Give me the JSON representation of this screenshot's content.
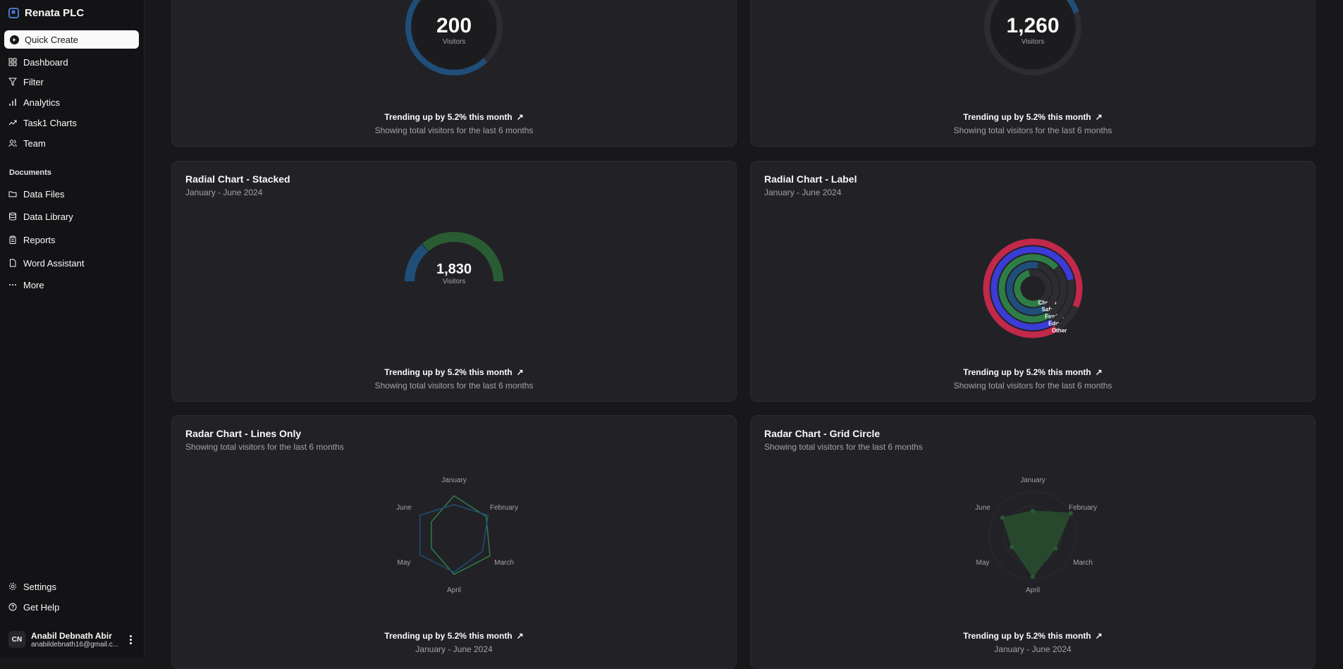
{
  "sidebar": {
    "brand": "Renata PLC",
    "quick_create": "Quick Create",
    "nav": [
      {
        "label": "Dashboard",
        "icon": "dashboard-icon"
      },
      {
        "label": "Filter",
        "icon": "filter-icon"
      },
      {
        "label": "Analytics",
        "icon": "analytics-icon"
      },
      {
        "label": "Task1 Charts",
        "icon": "trend-icon"
      },
      {
        "label": "Team",
        "icon": "team-icon"
      }
    ],
    "documents_label": "Documents",
    "documents": [
      {
        "label": "Data Files",
        "icon": "folder-icon"
      },
      {
        "label": "Data Library",
        "icon": "database-icon"
      },
      {
        "label": "Reports",
        "icon": "clipboard-icon"
      },
      {
        "label": "Word Assistant",
        "icon": "file-icon"
      },
      {
        "label": "More",
        "icon": "ellipsis-icon"
      }
    ],
    "footer": [
      {
        "label": "Settings",
        "icon": "gear-icon"
      },
      {
        "label": "Get Help",
        "icon": "help-icon"
      }
    ],
    "user": {
      "initials": "CN",
      "name": "Anabil Debnath Abir",
      "email": "anabildebnath16@gmail.c..."
    }
  },
  "common": {
    "trend": "Trending up by 5.2% this month",
    "footer_visitors": "Showing total visitors for the last 6 months",
    "date_range": "January - June 2024",
    "visitors_label": "Visitors"
  },
  "cards": {
    "top_left": {
      "value": "200"
    },
    "top_right": {
      "value": "1,260"
    },
    "stacked": {
      "title": "Radial Chart - Stacked",
      "subtitle": "January - June 2024",
      "value": "1,830"
    },
    "label": {
      "title": "Radial Chart - Label",
      "subtitle": "January - June 2024"
    },
    "radar_lines": {
      "title": "Radar Chart - Lines Only",
      "subtitle": "Showing total visitors for the last 6 months"
    },
    "radar_grid": {
      "title": "Radar Chart - Grid Circle",
      "subtitle": "Showing total visitors for the last 6 months"
    }
  },
  "chart_data": [
    {
      "type": "radial",
      "id": "top-left",
      "value": 200,
      "label": "Visitors",
      "fill_fraction": 0.62
    },
    {
      "type": "radial",
      "id": "top-right",
      "value": 1260,
      "label": "Visitors",
      "fill_fraction": 0.2
    },
    {
      "type": "radial-stacked",
      "value": 1830,
      "label": "Visitors",
      "series": [
        {
          "name": "segment-1",
          "value": 0.27,
          "color": "#1f4e79"
        },
        {
          "name": "segment-2",
          "value": 0.73,
          "color": "#2a5c34"
        }
      ]
    },
    {
      "type": "radial-label",
      "series": [
        {
          "name": "Chrome",
          "value": 0.55,
          "color": "#2e7d46"
        },
        {
          "name": "Safari",
          "value": 0.62,
          "color": "#1f4e79"
        },
        {
          "name": "Firefox",
          "value": 0.72,
          "color": "#2e7d46"
        },
        {
          "name": "Edge",
          "value": 0.8,
          "color": "#3b3bd6"
        },
        {
          "name": "Other",
          "value": 0.9,
          "color": "#c2284a"
        }
      ]
    },
    {
      "type": "radar",
      "id": "lines-only",
      "axes": [
        "January",
        "February",
        "March",
        "April",
        "May",
        "June"
      ],
      "series": [
        {
          "values": [
            0.9,
            0.85,
            0.95,
            0.9,
            0.6,
            0.6
          ],
          "color": "#2e7d46"
        },
        {
          "values": [
            0.7,
            0.9,
            0.75,
            0.85,
            0.9,
            0.9
          ],
          "color": "#1f4e79"
        }
      ]
    },
    {
      "type": "radar",
      "id": "grid-circle",
      "axes": [
        "January",
        "February",
        "March",
        "April",
        "May",
        "June"
      ],
      "series": [
        {
          "values": [
            0.55,
            1.0,
            0.6,
            0.95,
            0.55,
            0.8
          ],
          "color": "#27482d"
        }
      ]
    }
  ],
  "colors": {
    "accent_blue": "#1f4e79",
    "accent_green": "#2a5c34",
    "bg": "#18181b",
    "card": "#222226"
  }
}
